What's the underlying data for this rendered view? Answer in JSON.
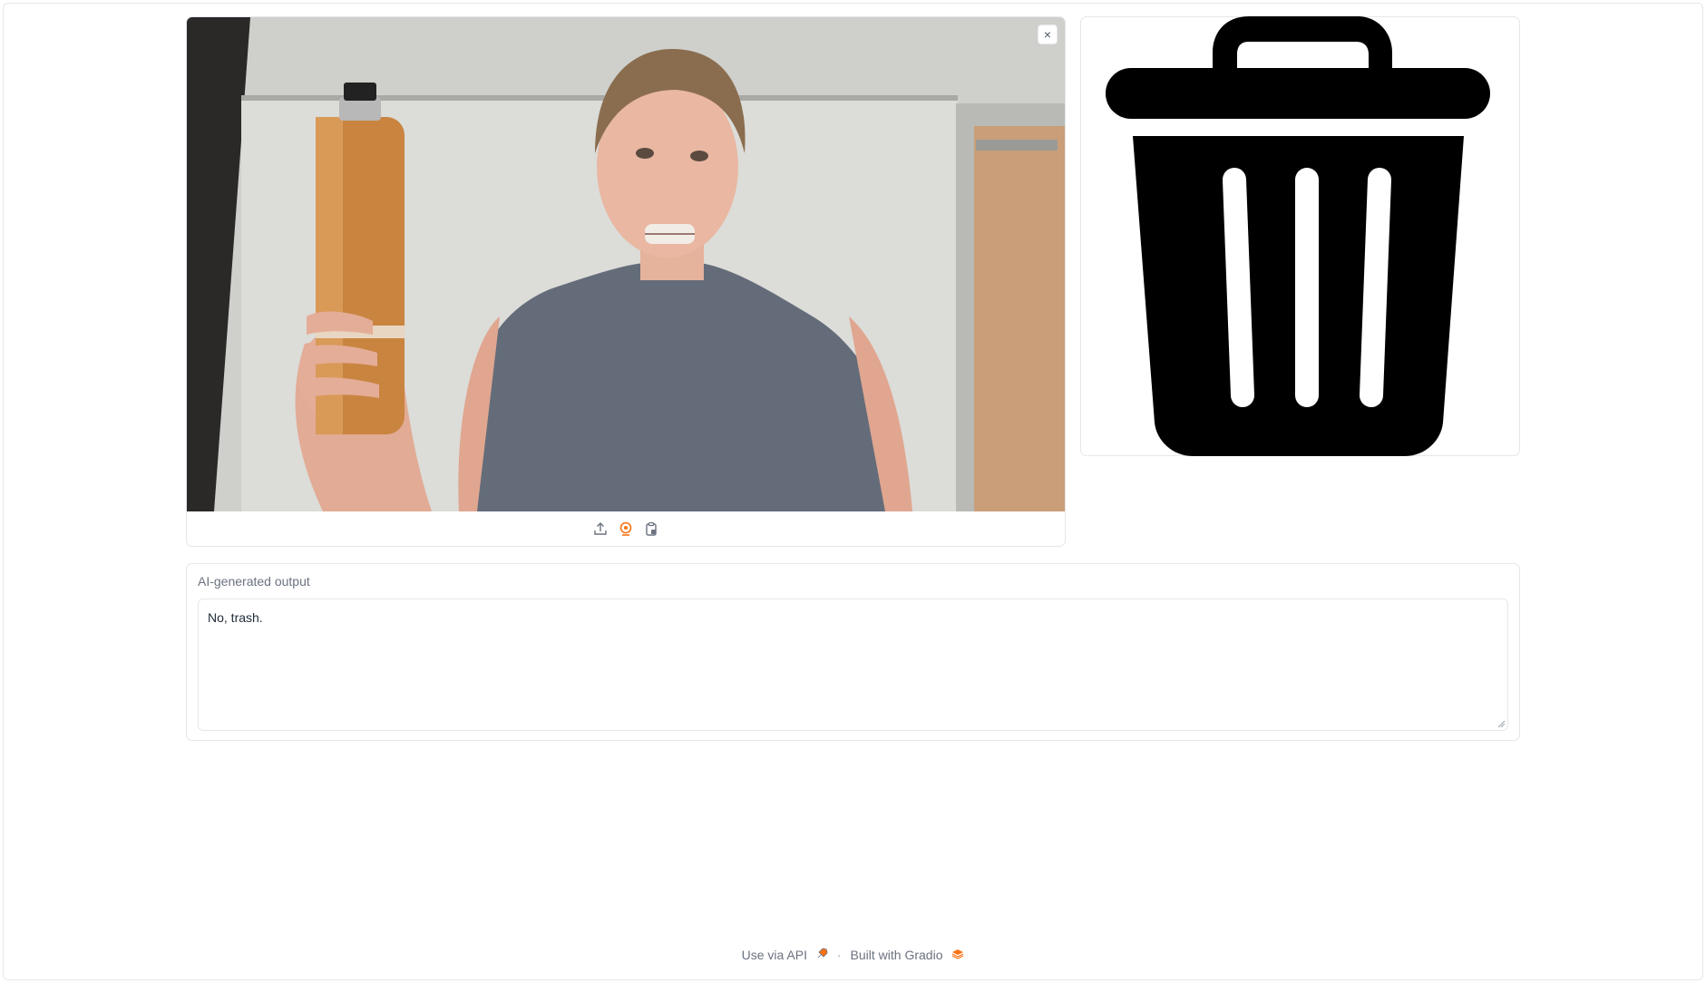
{
  "image_input": {
    "clear_button": "×",
    "sources": [
      {
        "name": "upload-icon"
      },
      {
        "name": "webcam-icon"
      },
      {
        "name": "clipboard-icon"
      }
    ]
  },
  "output_image": {
    "icon": "trash-icon"
  },
  "output_text": {
    "label": "AI-generated output",
    "value": "No, trash."
  },
  "footer": {
    "api_label": "Use via API",
    "separator": "·",
    "built_label": "Built with Gradio"
  },
  "colors": {
    "accent": "#f97316",
    "border": "#e5e7eb",
    "muted_text": "#6b7280"
  }
}
